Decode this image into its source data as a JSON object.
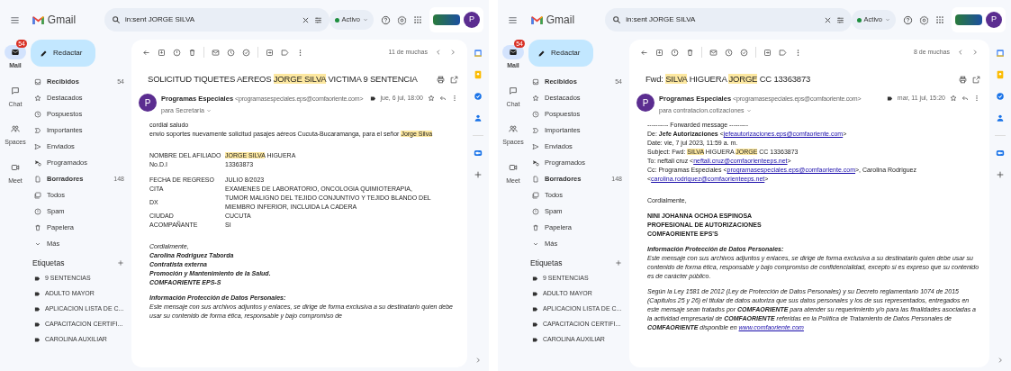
{
  "panels": [
    {
      "brand": "Gmail",
      "search": {
        "value": "in:sent JORGE SILVA"
      },
      "status": "Activo",
      "avatar": "P",
      "rail": [
        {
          "label": "Mail",
          "selected": true,
          "badge": "54"
        },
        {
          "label": "Chat",
          "selected": false
        },
        {
          "label": "Spaces",
          "selected": false
        },
        {
          "label": "Meet",
          "selected": false
        }
      ],
      "compose": "Redactar",
      "folders": [
        {
          "label": "Recibidos",
          "count": "54",
          "bold": true
        },
        {
          "label": "Destacados",
          "bold": false
        },
        {
          "label": "Pospuestos",
          "bold": false
        },
        {
          "label": "Importantes",
          "bold": false
        },
        {
          "label": "Enviados",
          "bold": false
        },
        {
          "label": "Programados",
          "bold": false
        },
        {
          "label": "Borradores",
          "count": "148",
          "bold": true
        },
        {
          "label": "Todos",
          "bold": false
        },
        {
          "label": "Spam",
          "bold": false
        },
        {
          "label": "Papelera",
          "bold": false
        },
        {
          "label": "Más",
          "bold": false
        }
      ],
      "labels_title": "Etiquetas",
      "labels": [
        "9 SENTENCIAS",
        "ADULTO MAYOR",
        "APLICACION LISTA DE C...",
        "CAPACITACION CERTIFI...",
        "CAROLINA AUXILIAR"
      ],
      "position": "11 de muchas",
      "subject": [
        {
          "text": "SOLICITUD TIQUETES AEREOS ",
          "kind": "plain"
        },
        {
          "text": "JORGE SILVA",
          "kind": "highlight"
        },
        {
          "text": " VICTIMA 9 SENTENCIA",
          "kind": "plain"
        }
      ],
      "sender": {
        "avatar": "P",
        "name": "Programas Especiales",
        "email": "<programasespeciales.eps@comfaoriente.com>",
        "to": "para Secretaria",
        "date": "jue, 6 jul, 18:00"
      },
      "body": [
        {
          "kind": "text",
          "segments": [
            {
              "text": "cordial saludo",
              "kind": "plain"
            }
          ]
        },
        {
          "kind": "text",
          "segments": [
            {
              "text": "envio soportes nuevamente  solicitud pasajes aéreos Cucuta-Bucaramanga,  para el señor ",
              "kind": "plain"
            },
            {
              "text": "Jorge Silva",
              "kind": "highlight"
            }
          ]
        },
        {
          "kind": "gap"
        },
        {
          "kind": "gap"
        },
        {
          "kind": "field",
          "label": "NOMBRE DEL AFILIADO",
          "value": [
            {
              "text": "JORGE SILVA",
              "kind": "highlight"
            },
            {
              "text": " HIGUERA",
              "kind": "plain"
            }
          ]
        },
        {
          "kind": "field",
          "label": "No.D.I",
          "value": [
            {
              "text": "13363873",
              "kind": "plain"
            }
          ]
        },
        {
          "kind": "gap"
        },
        {
          "kind": "field",
          "label": "FECHA DE REGRESO",
          "value": [
            {
              "text": "JULIO 8/2023",
              "kind": "plain"
            }
          ]
        },
        {
          "kind": "field",
          "label": "CITA",
          "value": [
            {
              "text": "EXAMENES DE LABORATORIO, ONCOLOGIA QUIMIOTERAPIA,",
              "kind": "plain"
            }
          ]
        },
        {
          "kind": "field",
          "label": "DX",
          "value": [
            {
              "text": "TUMOR MALIGNO DEL TEJIDO CONJUNTIVO Y TEJIDO BLANDO DEL MIEMBRO INFERIOR, INCLUIDA LA CADERA",
              "kind": "plain"
            }
          ]
        },
        {
          "kind": "field",
          "label": "CIUDAD",
          "value": [
            {
              "text": "CUCUTA",
              "kind": "plain"
            }
          ]
        },
        {
          "kind": "field",
          "label": "ACOMPAÑANTE",
          "value": [
            {
              "text": "SI",
              "kind": "plain"
            }
          ]
        },
        {
          "kind": "gap"
        },
        {
          "kind": "gap"
        },
        {
          "kind": "italic",
          "segments": [
            {
              "text": "Cordialmente,",
              "kind": "plain"
            }
          ]
        },
        {
          "kind": "bold-italic",
          "segments": [
            {
              "text": "Carolina Rodriguez Taborda",
              "kind": "plain"
            }
          ]
        },
        {
          "kind": "bold-italic",
          "segments": [
            {
              "text": "Contratista externa",
              "kind": "plain"
            }
          ]
        },
        {
          "kind": "bold-italic",
          "segments": [
            {
              "text": "Promoción y Mantenimiento de la Salud.",
              "kind": "plain"
            }
          ]
        },
        {
          "kind": "bold-italic",
          "segments": [
            {
              "text": "COMFAORIENTE EPS-S",
              "kind": "plain"
            }
          ]
        },
        {
          "kind": "gap"
        },
        {
          "kind": "bold-italic",
          "segments": [
            {
              "text": "Información Protección de Datos Personales:",
              "kind": "plain"
            }
          ]
        },
        {
          "kind": "italic",
          "segments": [
            {
              "text": "Este mensaje con sus archivos adjuntos y enlaces, se dirige de forma exclusiva a su destinatario quien debe usar su contenido de forma ética, responsable y bajo compromiso de",
              "kind": "plain"
            }
          ]
        }
      ]
    },
    {
      "brand": "Gmail",
      "search": {
        "value": "in:sent JORGE SILVA"
      },
      "status": "Activo",
      "avatar": "P",
      "rail": [
        {
          "label": "Mail",
          "selected": true,
          "badge": "54"
        },
        {
          "label": "Chat",
          "selected": false
        },
        {
          "label": "Spaces",
          "selected": false
        },
        {
          "label": "Meet",
          "selected": false
        }
      ],
      "compose": "Redactar",
      "folders": [
        {
          "label": "Recibidos",
          "count": "54",
          "bold": true
        },
        {
          "label": "Destacados",
          "bold": false
        },
        {
          "label": "Pospuestos",
          "bold": false
        },
        {
          "label": "Importantes",
          "bold": false
        },
        {
          "label": "Enviados",
          "bold": false
        },
        {
          "label": "Programados",
          "bold": false
        },
        {
          "label": "Borradores",
          "count": "148",
          "bold": true
        },
        {
          "label": "Todos",
          "bold": false
        },
        {
          "label": "Spam",
          "bold": false
        },
        {
          "label": "Papelera",
          "bold": false
        },
        {
          "label": "Más",
          "bold": false
        }
      ],
      "labels_title": "Etiquetas",
      "labels": [
        "9 SENTENCIAS",
        "ADULTO MAYOR",
        "APLICACION LISTA DE C...",
        "CAPACITACION CERTIFI...",
        "CAROLINA AUXILIAR"
      ],
      "position": "8 de muchas",
      "subject": [
        {
          "text": "Fwd: ",
          "kind": "plain"
        },
        {
          "text": "SILVA",
          "kind": "highlight"
        },
        {
          "text": " HIGUERA ",
          "kind": "plain"
        },
        {
          "text": "JORGE",
          "kind": "highlight"
        },
        {
          "text": " CC 13363873",
          "kind": "plain"
        }
      ],
      "sender": {
        "avatar": "P",
        "name": "Programas Especiales",
        "email": "<programasespeciales.eps@comfaoriente.com>",
        "to": "para contratacion.cotizaciones",
        "date": "mar, 11 jul, 15:20"
      },
      "body": [
        {
          "kind": "text",
          "segments": [
            {
              "text": "---------- Forwarded message ---------",
              "kind": "plain"
            }
          ]
        },
        {
          "kind": "text",
          "segments": [
            {
              "text": "De: **Jefe Autorizaciones** <",
              "kind": "plain"
            },
            {
              "text": "jefeautorizaciones.eps@comfaoriente.com",
              "kind": "link"
            },
            {
              "text": ">",
              "kind": "plain"
            }
          ]
        },
        {
          "kind": "text",
          "segments": [
            {
              "text": "Date: vie, 7 jul 2023, 11:59 a. m.",
              "kind": "plain"
            }
          ]
        },
        {
          "kind": "text",
          "segments": [
            {
              "text": "Subject: Fwd: ",
              "kind": "plain"
            },
            {
              "text": "SILVA",
              "kind": "highlight"
            },
            {
              "text": " HIGUERA ",
              "kind": "plain"
            },
            {
              "text": "JORGE",
              "kind": "highlight"
            },
            {
              "text": " CC 13363873",
              "kind": "plain"
            }
          ]
        },
        {
          "kind": "text",
          "segments": [
            {
              "text": "To: neftali cruz <",
              "kind": "plain"
            },
            {
              "text": "neftali.cruz@comfaorienteeps.net",
              "kind": "link"
            },
            {
              "text": ">",
              "kind": "plain"
            }
          ]
        },
        {
          "kind": "text",
          "segments": [
            {
              "text": "Cc: Programas Especiales <",
              "kind": "plain"
            },
            {
              "text": "programasespeciales.eps@comfaoriente.com",
              "kind": "link"
            },
            {
              "text": ">, Carolina Rodriguez <",
              "kind": "plain"
            },
            {
              "text": "carolina.rodriguez@comfaorienteeps.net",
              "kind": "link"
            },
            {
              "text": ">",
              "kind": "plain"
            }
          ]
        },
        {
          "kind": "gap"
        },
        {
          "kind": "gap"
        },
        {
          "kind": "text",
          "segments": [
            {
              "text": "Cordialmente,",
              "kind": "plain"
            }
          ]
        },
        {
          "kind": "gap"
        },
        {
          "kind": "bold",
          "segments": [
            {
              "text": "NINI JOHANNA OCHOA ESPINOSA",
              "kind": "plain"
            }
          ]
        },
        {
          "kind": "bold",
          "segments": [
            {
              "text": "PROFESIONAL DE AUTORIZACIONES",
              "kind": "plain"
            }
          ]
        },
        {
          "kind": "bold",
          "segments": [
            {
              "text": "COMFAORIENTE EPS'S",
              "kind": "plain"
            }
          ]
        },
        {
          "kind": "gap"
        },
        {
          "kind": "bold-italic",
          "segments": [
            {
              "text": "Información Protección de Datos Personales:",
              "kind": "plain"
            }
          ]
        },
        {
          "kind": "italic",
          "segments": [
            {
              "text": "Este mensaje con sus archivos adjuntos y enlaces, se dirige de forma exclusiva a su destinatario quien debe usar su contenido de forma ética, responsable y bajo compromiso de confidencialidad, excepto si es expreso que su contenido es de carácter público.",
              "kind": "plain"
            }
          ]
        },
        {
          "kind": "gap"
        },
        {
          "kind": "italic",
          "segments": [
            {
              "text": "Según la Ley 1581 de 2012 (Ley de Protección de Datos Personales) y su Decreto reglamentario 1074 de 2015 (Capítulos 25 y 26) el titular de datos autoriza que sus datos personales y los de sus representados, entregados en este mensaje sean tratados por **COMFAORIENTE** para atender su requerimiento y/o para las finalidades asociadas a la actividad empresarial de **COMFAORIENTE** referidas en la Política de Tratamiento de Datos Personales de **COMFAORIENTE** disponible en ",
              "kind": "plain"
            },
            {
              "text": "www.comfaoriente.com",
              "kind": "link"
            }
          ]
        }
      ]
    }
  ]
}
